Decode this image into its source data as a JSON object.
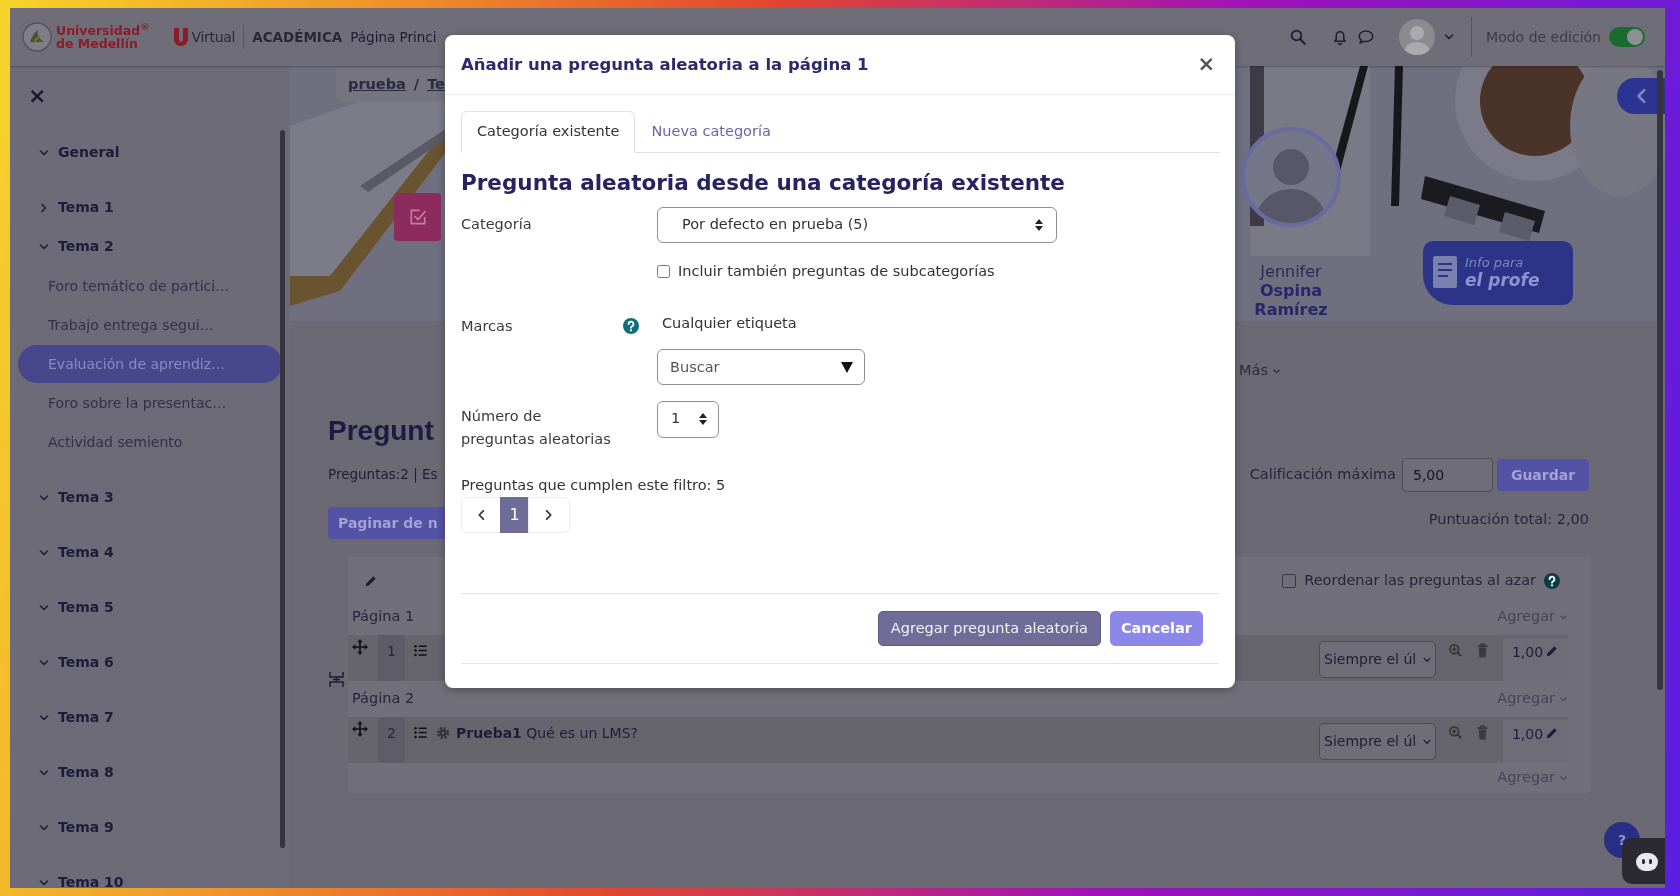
{
  "navbar": {
    "logo": {
      "line_1": "Universidad$^{®}$",
      "line_2": "de Medellín"
    },
    "virtual_label": "Virtual",
    "section_label": "ACADÉMICA",
    "nav_links": [
      "Página Princi"
    ],
    "edit_mode": {
      "label": "Modo de edición",
      "on": true
    }
  },
  "sidebar": {
    "close_label": "×",
    "sections": [
      {
        "label": "General",
        "expanded": true
      },
      {
        "label": "Tema 1",
        "expanded": false
      },
      {
        "label": "Tema 2",
        "expanded": true,
        "children": [
          {
            "label": "Foro temático de partici…",
            "selected": false
          },
          {
            "label": "Trabajo entrega segui…",
            "selected": false
          },
          {
            "label": "Evaluación de aprendiz…",
            "selected": true
          },
          {
            "label": "Foro sobre la presentac…",
            "selected": false
          },
          {
            "label": "Actividad semiento",
            "selected": false
          }
        ]
      },
      {
        "label": "Tema 3",
        "expanded": true
      },
      {
        "label": "Tema 4",
        "expanded": true
      },
      {
        "label": "Tema 5",
        "expanded": true
      },
      {
        "label": "Tema 6",
        "expanded": true
      },
      {
        "label": "Tema 7",
        "expanded": true
      },
      {
        "label": "Tema 8",
        "expanded": true
      },
      {
        "label": "Tema 9",
        "expanded": true
      },
      {
        "label": "Tema 10",
        "expanded": true
      }
    ]
  },
  "breadcrumb": {
    "items": [
      "prueba",
      "Te"
    ],
    "separator": "/"
  },
  "course_header": {
    "first_name": "Jennifer",
    "last_name": "Ospina Ramírez",
    "info_badge": [
      "Info para",
      "el profe"
    ]
  },
  "secondary_nav": {
    "more_label": "Más"
  },
  "quiz": {
    "title": "Pregunt",
    "summary": "Preguntas:2 | Es",
    "repaginate_button": "Paginar de n",
    "max_grade": {
      "label": "Calificación máxima",
      "value": "5,00",
      "button": "Guardar"
    },
    "total": "Puntuación total: 2,00",
    "shuffle": {
      "label": "Reordenar las preguntas al azar",
      "checked": false
    },
    "pages": [
      {
        "label": "Página 1",
        "add_label": "Agregar",
        "questions": [
          {
            "number": "1",
            "requeue": "Siempre el úl",
            "mark": "1,00"
          }
        ]
      },
      {
        "label": "Página 2",
        "add_label": "Agregar",
        "questions": [
          {
            "number": "2",
            "text": "**Prueba1** Qué es un LMS?",
            "requeue": "Siempre el úl",
            "mark": "1,00"
          }
        ]
      }
    ],
    "end_add_label": "Agregar"
  },
  "help_button": "?",
  "modal": {
    "title": "Añadir una pregunta aleatoria a la página 1",
    "close_label": "×",
    "tabs": [
      {
        "label": "Categoría existente",
        "selected": true
      },
      {
        "label": "Nueva categoría",
        "selected": false
      }
    ],
    "heading": "Pregunta aleatoria desde una categoría existente",
    "fields": [
      {
        "kind": "select",
        "label": "Categoría",
        "value": "Por defecto en prueba (5)"
      },
      {
        "kind": "checkbox",
        "label": "Incluir también preguntas de subcategorías",
        "checked": false
      },
      {
        "kind": "tags",
        "label": "Marcas",
        "value": "Cualquier etiqueta",
        "placeholder": "Buscar"
      },
      {
        "kind": "number",
        "label": "Número de preguntas aleatorias",
        "value": "1"
      }
    ],
    "match_count": "Preguntas que cumplen este filtro: 5",
    "pagination": [
      {
        "label": "1",
        "selected": true
      }
    ],
    "buttons": [
      {
        "label": "Agregar pregunta aleatoria",
        "kind": "primary"
      },
      {
        "label": "Cancelar",
        "kind": "secondary"
      }
    ]
  }
}
